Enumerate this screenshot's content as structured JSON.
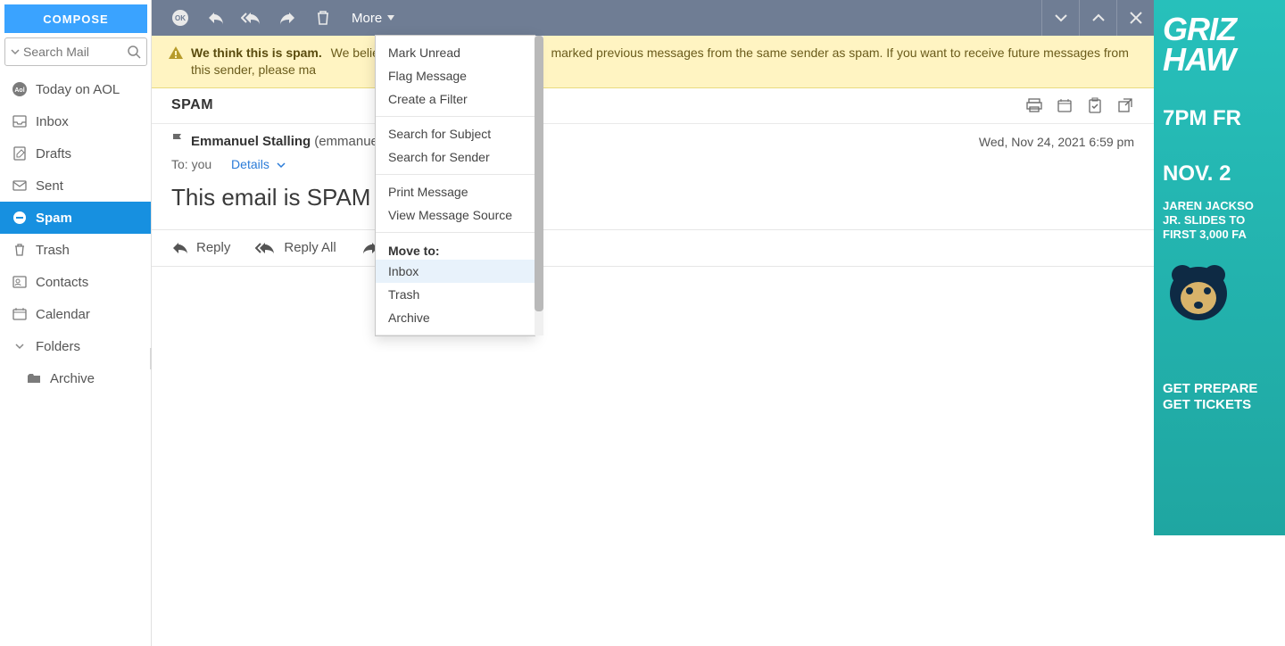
{
  "sidebar": {
    "compose": "COMPOSE",
    "search_placeholder": "Search Mail",
    "today": "Today on AOL",
    "items": [
      {
        "label": "Inbox"
      },
      {
        "label": "Drafts"
      },
      {
        "label": "Sent"
      },
      {
        "label": "Spam"
      },
      {
        "label": "Trash"
      },
      {
        "label": "Contacts"
      },
      {
        "label": "Calendar"
      }
    ],
    "folders_label": "Folders",
    "archive_label": "Archive"
  },
  "toolbar": {
    "more_label": "More"
  },
  "more_menu": {
    "group1": [
      {
        "label": "Mark Unread"
      },
      {
        "label": "Flag Message"
      },
      {
        "label": "Create a Filter"
      }
    ],
    "group2": [
      {
        "label": "Search for Subject"
      },
      {
        "label": "Search for Sender"
      }
    ],
    "group3": [
      {
        "label": "Print Message"
      },
      {
        "label": "View Message Source"
      }
    ],
    "move_header": "Move to:",
    "move_items": [
      {
        "label": "Inbox"
      },
      {
        "label": "Trash"
      },
      {
        "label": "Archive"
      }
    ]
  },
  "banner": {
    "title": "We think this is spam.",
    "body_a": "We believe",
    "body_b": "marked previous messages from the same sender as spam. If you want to receive future messages from this sender, please ma"
  },
  "folder_row": {
    "name": "SPAM"
  },
  "message": {
    "from_name": "Emmanuel Stalling",
    "from_email": "(emmanuelkstal",
    "date": "Wed, Nov 24, 2021 6:59 pm",
    "to_label": "To:",
    "to_value": "you",
    "details": "Details",
    "subject": "This email is SPAM"
  },
  "reply_bar": {
    "reply": "Reply",
    "reply_all": "Reply All",
    "forward": ""
  },
  "ad": {
    "h1a": "GRIZ",
    "h1b": "HAW",
    "h2a": "7PM FR",
    "h2b": "NOV. 2",
    "small": "JAREN JACKSO\nJR. SLIDES TO\nFIRST 3,000 FA",
    "foot": "GET PREPARE\nGET TICKETS"
  }
}
